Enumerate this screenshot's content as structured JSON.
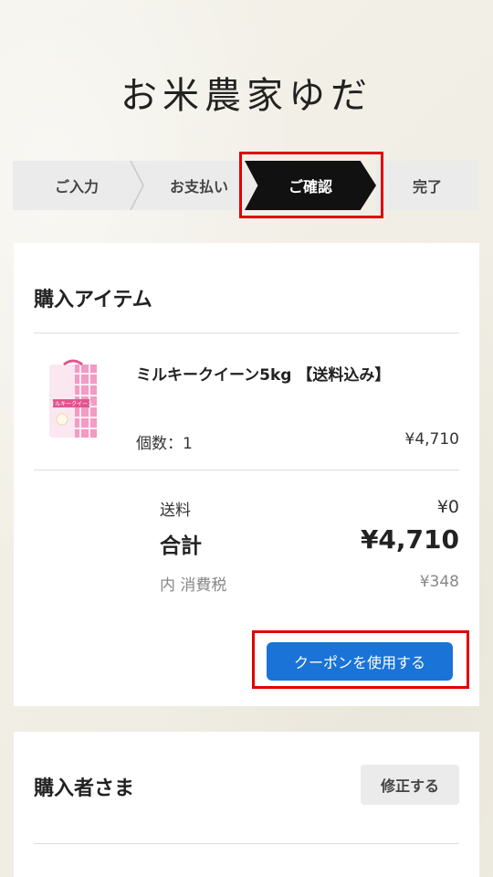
{
  "brand": "お米農家ゆだ",
  "steps": [
    "ご入力",
    "お支払い",
    "ご確認",
    "完了"
  ],
  "items_section": {
    "title": "購入アイテム",
    "product": {
      "name": "ミルキークイーン5kg 【送料込み】",
      "qty_label": "個数：1",
      "price": "¥4,710",
      "package_text": "ミルキークイーン"
    },
    "shipping_label": "送料",
    "shipping_value": "¥0",
    "total_label": "合計",
    "total_value": "¥4,710",
    "tax_label": "内 消費税",
    "tax_value": "¥348",
    "coupon_button": "クーポンを使用する"
  },
  "buyer_section": {
    "title": "購入者さま",
    "edit_button": "修正する"
  },
  "colors": {
    "accent": "#1a73d6",
    "highlight": "#e00000",
    "active_step": "#111111"
  }
}
